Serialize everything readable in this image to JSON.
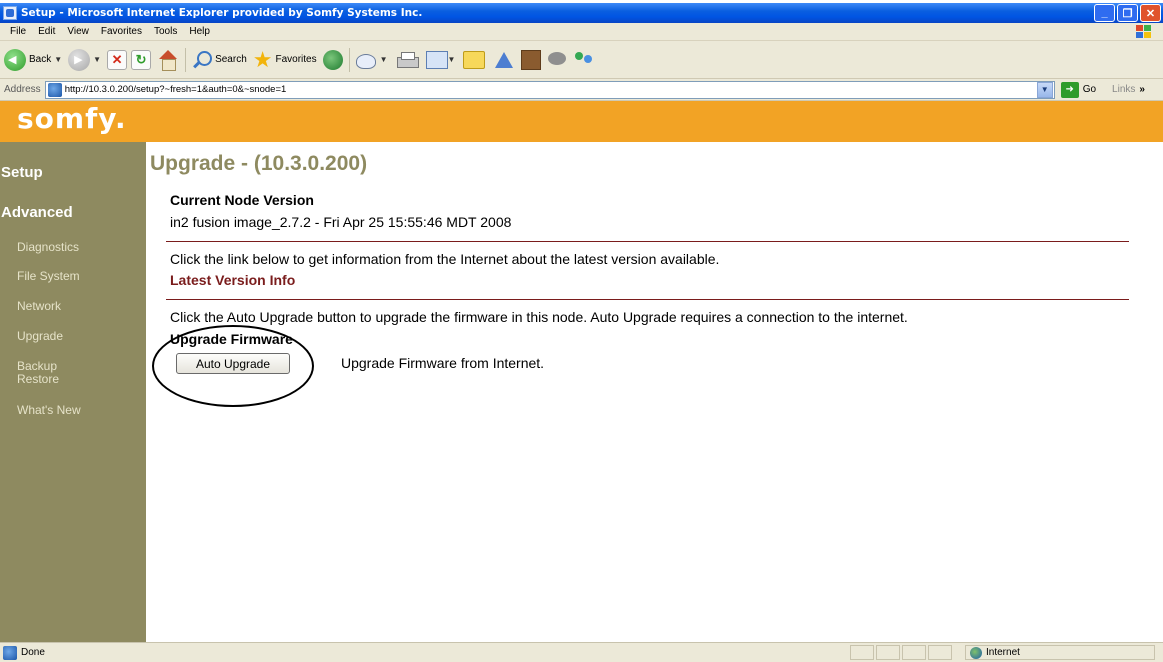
{
  "browser": {
    "title": "Setup - Microsoft Internet Explorer provided by Somfy Systems Inc.",
    "menu": [
      "File",
      "Edit",
      "View",
      "Favorites",
      "Tools",
      "Help"
    ],
    "toolbar": {
      "back": "Back",
      "search": "Search",
      "favorites": "Favorites"
    },
    "address_label": "Address",
    "url": "http://10.3.0.200/setup?~fresh=1&auth=0&~snode=1",
    "go": "Go",
    "links": "Links",
    "status": "Done",
    "zone": "Internet"
  },
  "site": {
    "logo": "somfy.",
    "brand_color": "#f2a325",
    "sidebar_color": "#8e8a60"
  },
  "sidebar": {
    "setup": "Setup",
    "advanced": "Advanced",
    "items": [
      "Diagnostics",
      "File System",
      "Network",
      "Upgrade",
      "Backup",
      "Restore",
      "What's New"
    ]
  },
  "main": {
    "title": "Upgrade - (10.3.0.200)",
    "current_node_heading": "Current Node Version",
    "current_node_value": "in2 fusion image_2.7.2 - Fri Apr 25 15:55:46 MDT 2008",
    "info_text": "Click the link below to get information from the Internet about the latest version available.",
    "latest_link": "Latest Version Info",
    "auto_text": "Click the Auto Upgrade button to upgrade the firmware in this node. Auto Upgrade requires a connection to the internet.",
    "firmware_heading": "Upgrade Firmware",
    "auto_button": "Auto Upgrade",
    "auto_desc": "Upgrade Firmware from Internet."
  }
}
